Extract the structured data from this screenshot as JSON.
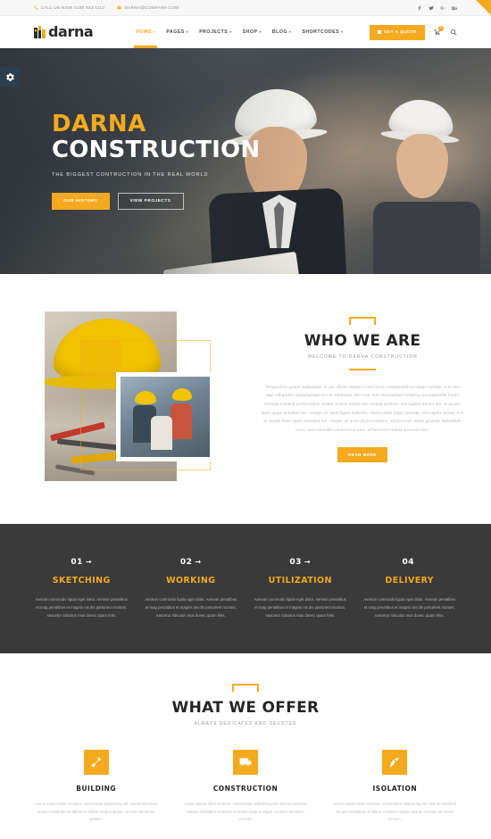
{
  "topbar": {
    "phone": "CALL US NOW 0100 943 1112",
    "email": "DARNA@COMPANY.COM",
    "social": [
      {
        "name": "facebook-icon",
        "label": "f"
      },
      {
        "name": "twitter-icon",
        "label": "t"
      },
      {
        "name": "google-plus-icon",
        "label": "g+"
      },
      {
        "name": "behance-icon",
        "label": "Be"
      }
    ]
  },
  "header": {
    "logo_text": "darna",
    "nav": [
      {
        "label": "HOME",
        "caret": "▾",
        "active": true
      },
      {
        "label": "PAGES",
        "caret": "▾",
        "active": false
      },
      {
        "label": "PROJECTS",
        "caret": "▾",
        "active": false
      },
      {
        "label": "SHOP",
        "caret": "▾",
        "active": false
      },
      {
        "label": "BLOG",
        "caret": "▾",
        "active": false
      },
      {
        "label": "SHORTCODES",
        "caret": "▾",
        "active": false
      }
    ],
    "quote_label": "GET A QUOTE",
    "cart_count": "0"
  },
  "hero": {
    "title_line1": "DARNA",
    "title_line2": "CONSTRUCTION",
    "subtitle": "THE BIGGEST CONTRUCTION IN THE REAL WORLD",
    "btn_primary": "OUR HISTORY",
    "btn_secondary": "VIEW PROJECTS"
  },
  "about": {
    "title": "WHO WE ARE",
    "subtitle": "WELCOME TO DARNA CONSTRUCTION",
    "paragraph": "Temporibus autem quibusdam et aut officiis debitis is aut rerum necessitatibus saepe eveniet ut et seo iage voluptates repudiandae sint et molestiae non mea. Nor recusandae Creating a sustainable future through building preservation. Etiam viverra metus nec feugiat pretium, nisl sapien auctor dui, at iaculis diam quam tincidunt leo. Integer sit amet ligula molestie, ullamcorper turpis gravida, nisl sapien auctor dui, at iaculis diam quam tincidunt leo. Integer sit amet ligula molestie, ullamcorper turpis gravida. Bibendum risus. Sed convallis consectetur sem, id hendrerit massa posuere nec.",
    "read_more": "READ MORE"
  },
  "process": {
    "items": [
      {
        "number": "01",
        "arrow": "→",
        "title": "SKETCHING",
        "desc": "Aenean commodo ligula eget dolor. Aenean penatibus et mag penatibus et magnis nis dis parturient montes, nascetur ridiculus mus donec quam felis."
      },
      {
        "number": "02",
        "arrow": "→",
        "title": "WORKING",
        "desc": "Aenean commodo ligula eget dolor. Aenean penatibus et mag penatibus et magnis nis dis parturient montes, nascetur ridiculus mus donec quam felis."
      },
      {
        "number": "03",
        "arrow": "→",
        "title": "UTILIZATION",
        "desc": "Aenean commodo ligula eget dolor. Aenean penatibus et mag penatibus et magnis nis dis parturient montes, nascetur ridiculus mus donec quam felis."
      },
      {
        "number": "04",
        "arrow": "",
        "title": "DELIVERY",
        "desc": "Aenean commodo ligula eget dolor. Aenean penatibus et mag penatibus et magnis nis dis parturient montes, nascetur ridiculus mus donec quam felis."
      }
    ]
  },
  "offer": {
    "title": "WHAT WE OFFER",
    "subtitle": "ALWAYS DEDICATED AND DEVOTED",
    "cards": [
      {
        "icon": "hammer-icon",
        "title": "BUILDING",
        "desc": "Lorem ipsum dolor sit amet, consectetur adipisicing elit, sed do eiusmod tempor incididunt ut labore et dolore magna aliqua. Ut enim ad minim veniam."
      },
      {
        "icon": "truck-icon",
        "title": "CONSTRUCTION",
        "desc": "Lorem ipsum dolor sit amet, consectetur adipisicing elit, sed do eiusmod tempor incididunt ut labore et dolore magna aliqua. Ut enim ad minim veniam."
      },
      {
        "icon": "trowel-icon",
        "title": "ISOLATION",
        "desc": "Lorem ipsum dolor sit amet, consectetur adipisicing elit, sed do eiusmod tempor incididunt ut labore et dolore magna aliqua. Ut enim ad minim veniam."
      }
    ]
  },
  "colors": {
    "accent": "#f4a91e",
    "dark": "#3a3a3a",
    "settings_tab": "#2d3e50"
  }
}
